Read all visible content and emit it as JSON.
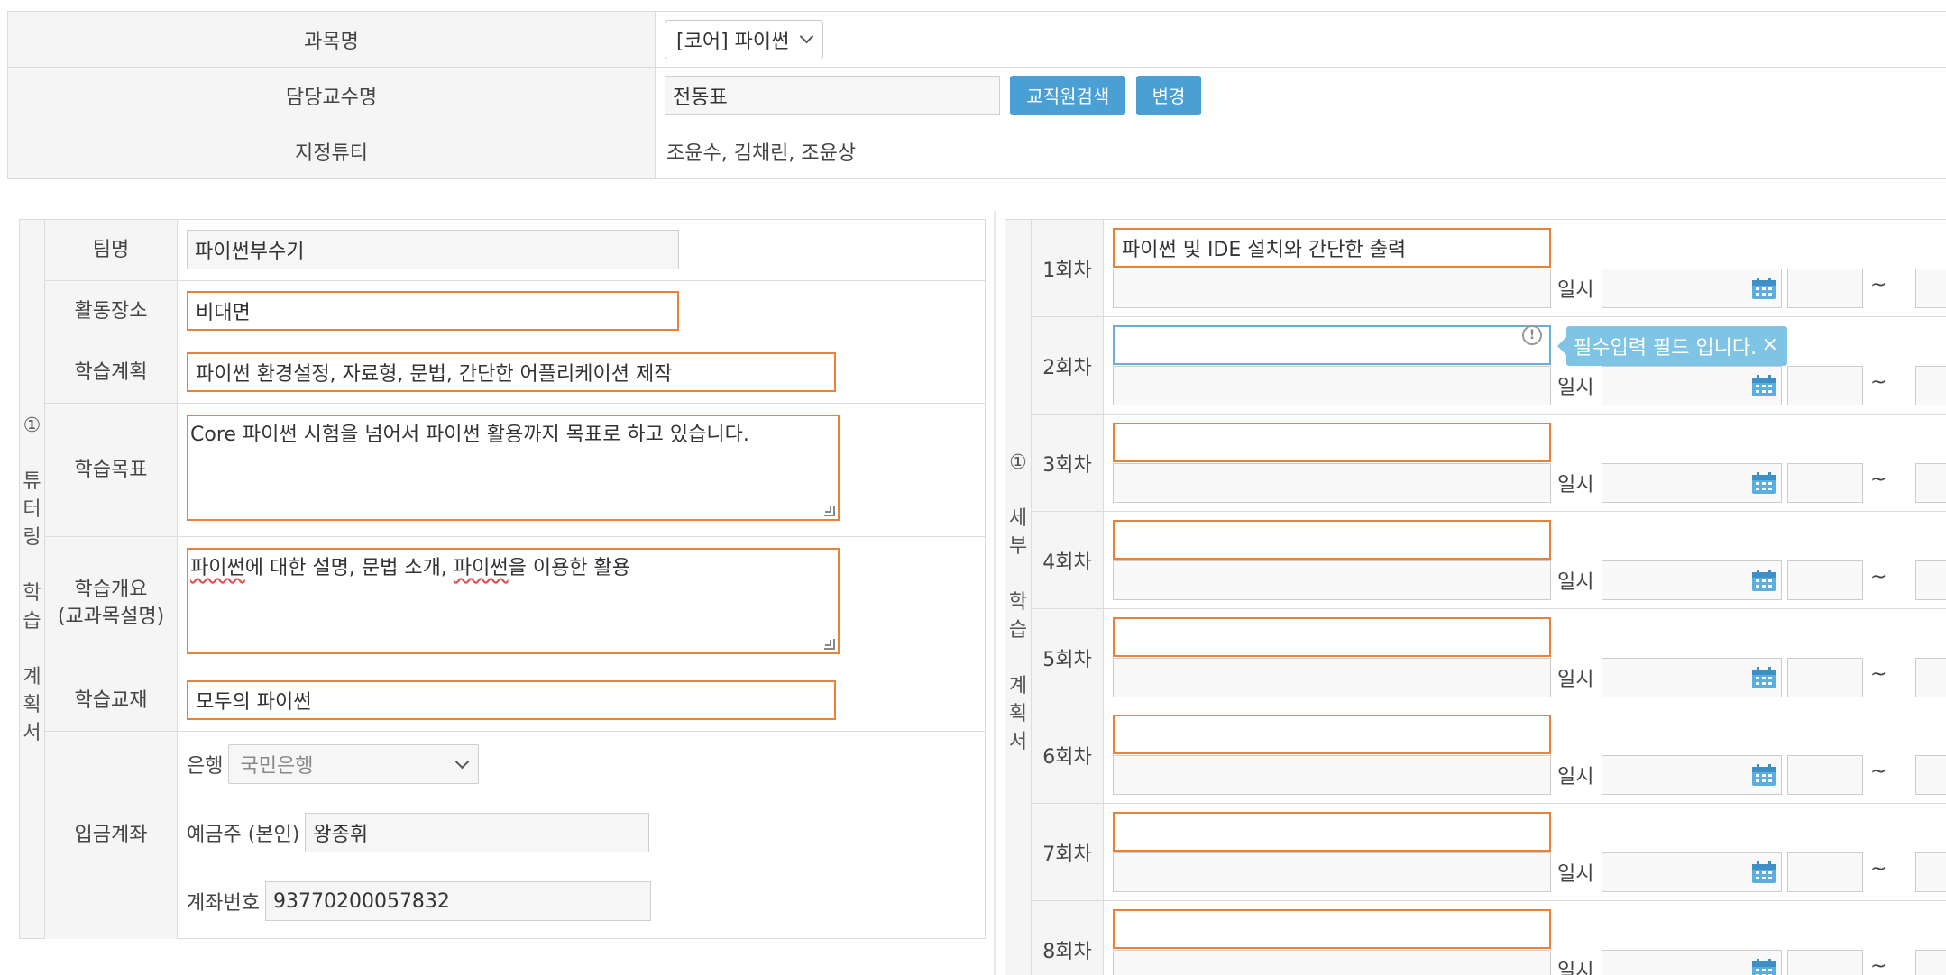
{
  "course": {
    "label": "과목명",
    "selected": "[코어] 파이썬"
  },
  "professor": {
    "label": "담당교수명",
    "value": "전동표",
    "search_button": "교직원검색",
    "change_button": "변경"
  },
  "tutee": {
    "label": "지정튜티",
    "value": "조윤수, 김채린, 조윤상"
  },
  "tutoring_plan": {
    "section_label_lines": [
      "①",
      "",
      "튜",
      "터",
      "링",
      "",
      "학",
      "습",
      "",
      "계",
      "획",
      "서"
    ],
    "team_name": {
      "label": "팀명",
      "value": "파이썬부수기"
    },
    "location": {
      "label": "활동장소",
      "value": "비대면"
    },
    "plan": {
      "label": "학습계획",
      "value": "파이썬 환경설정, 자료형, 문법, 간단한 어플리케이션 제작"
    },
    "goal": {
      "label": "학습목표",
      "value": "Core 파이썬 시험을 넘어서 파이썬 활용까지 목표로 하고 있습니다."
    },
    "overview": {
      "label_line1": "학습개요",
      "label_line2": "(교과목설명)",
      "seg1": "파이썬",
      "seg2": "에 대한 설명, 문법 소개, ",
      "seg3": "파이썬",
      "seg4": "을 이용한 활용"
    },
    "textbook": {
      "label": "학습교재",
      "value": "모두의 파이썬"
    },
    "account": {
      "label": "입금계좌",
      "bank_label": "은행",
      "bank_selected": "국민은행",
      "holder_label": "예금주 (본인)",
      "holder_value": "왕종휘",
      "number_label": "계좌번호",
      "number_value": "93770200057832"
    }
  },
  "detail_plan": {
    "section_label_lines": [
      "①",
      "",
      "세",
      "부",
      "",
      "학",
      "습",
      "",
      "계",
      "획",
      "서"
    ],
    "date_label": "일시",
    "tilde": "~",
    "sessions": [
      {
        "label": "1회차",
        "title": "파이썬 및 IDE 설치와 간단한 출력"
      },
      {
        "label": "2회차",
        "title": ""
      },
      {
        "label": "3회차",
        "title": ""
      },
      {
        "label": "4회차",
        "title": ""
      },
      {
        "label": "5회차",
        "title": ""
      },
      {
        "label": "6회차",
        "title": ""
      },
      {
        "label": "7회차",
        "title": ""
      },
      {
        "label": "8회차",
        "title": ""
      }
    ],
    "validation_tooltip": "필수입력 필드 입니다.",
    "tooltip_close": "×",
    "warning_mark": "!"
  },
  "colors": {
    "required_border": "#e8823a",
    "focus_border": "#6aaed6",
    "button_blue": "#4a9fd4",
    "tooltip_bg": "#7fc4e4",
    "label_bg": "#f5f5f5"
  }
}
